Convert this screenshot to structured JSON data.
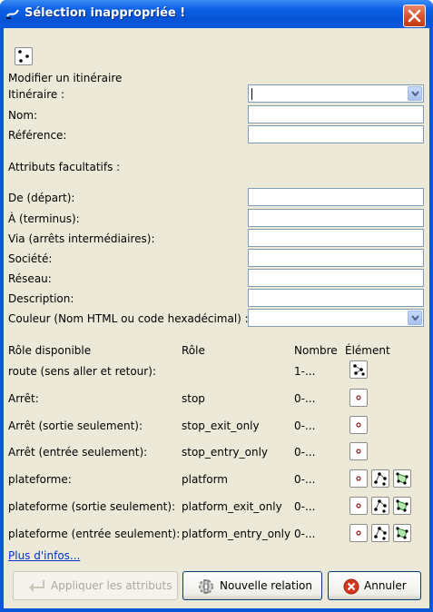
{
  "window": {
    "title": "Sélection inappropriée !"
  },
  "form": {
    "section_title": "Modifier un itinéraire",
    "itinerary_label": "Itinéraire :",
    "itinerary_value": "",
    "name_label": "Nom:",
    "reference_label": "Référence:",
    "optional_title": "Attributs facultatifs :",
    "from_label": "De (départ):",
    "to_label": "À (terminus):",
    "via_label": "Via (arrêts intermédiaires):",
    "operator_label": "Société:",
    "network_label": "Réseau:",
    "description_label": "Description:",
    "colour_label": "Couleur (Nom HTML ou code hexadécimal) :"
  },
  "roles_table": {
    "headers": [
      "Rôle disponible",
      "Rôle",
      "Nombre",
      "Élément"
    ],
    "rows": [
      {
        "available": "route (sens aller et retour):",
        "role": "",
        "count": "1-...",
        "elements": [
          "relation-icon"
        ]
      },
      {
        "available": "Arrêt:",
        "role": "stop",
        "count": "0-...",
        "elements": [
          "node-icon"
        ]
      },
      {
        "available": "Arrêt (sortie seulement):",
        "role": "stop_exit_only",
        "count": "0-...",
        "elements": [
          "node-icon"
        ]
      },
      {
        "available": "Arrêt (entrée seulement):",
        "role": "stop_entry_only",
        "count": "0-...",
        "elements": [
          "node-icon"
        ]
      },
      {
        "available": "plateforme:",
        "role": "platform",
        "count": "0-...",
        "elements": [
          "node-icon",
          "way-icon",
          "area-icon"
        ]
      },
      {
        "available": "plateforme (sortie seulement):",
        "role": "platform_exit_only",
        "count": "0-...",
        "elements": [
          "node-icon",
          "way-icon",
          "area-icon"
        ]
      },
      {
        "available": "plateforme (entrée seulement):",
        "role": "platform_entry_only",
        "count": "0-...",
        "elements": [
          "node-icon",
          "way-icon",
          "area-icon"
        ]
      }
    ]
  },
  "more_info_link": "Plus d'infos...",
  "buttons": {
    "apply": "Appliquer les attributs",
    "new_relation": "Nouvelle relation",
    "cancel": "Annuler"
  },
  "colors": {
    "title_bar": "#0a57d8",
    "dialog_bg": "#ece9d8",
    "field_border": "#7f9db9",
    "link": "#0033cc"
  }
}
